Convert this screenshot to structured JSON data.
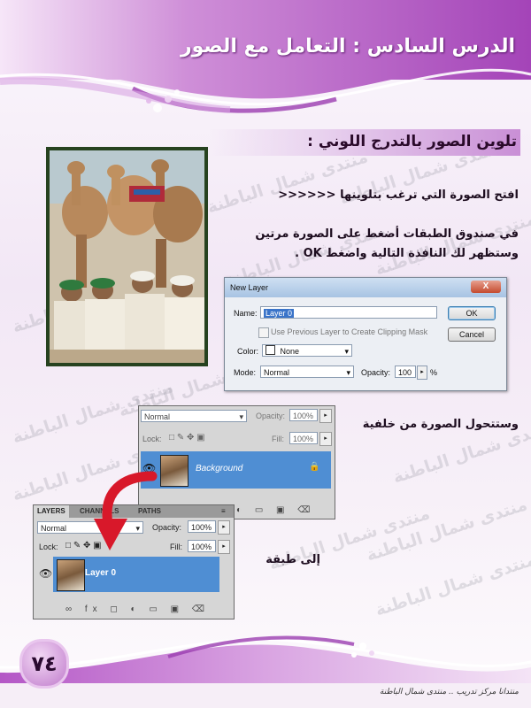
{
  "header": {
    "title": "الدرس السادس : التعامل مع الصور"
  },
  "section": {
    "title": "تلوين الصور بالتدرج اللوني :"
  },
  "watermark": {
    "text": "منتدى شمال الباطنة"
  },
  "instructions": {
    "line1": "افتح الصورة التي ترغب بتلوينها <<<<<<",
    "line2": "في صندوق الطبقات  أضغط على الصورة مرتين",
    "line3": "وستظهر لك النافذة التالية  واضغط OK .",
    "line4": "وستتحول الصورة من خلفية",
    "line5": "إلى طبقة"
  },
  "new_layer_dialog": {
    "title": "New Layer",
    "close_label": "X",
    "name_label": "Name:",
    "name_value": "Layer 0",
    "clipping_label": "Use Previous Layer to Create Clipping Mask",
    "color_label": "Color:",
    "color_value": "None",
    "mode_label": "Mode:",
    "mode_value": "Normal",
    "opacity_label": "Opacity:",
    "opacity_value": "100",
    "opacity_unit": "%",
    "ok_label": "OK",
    "cancel_label": "Cancel"
  },
  "panel_background": {
    "blend_mode": "Normal",
    "opacity_label": "Opacity:",
    "opacity_value": "100%",
    "lock_label": "Lock:",
    "fill_label": "Fill:",
    "fill_value": "100%",
    "layer_name": "Background"
  },
  "panel_layer0": {
    "tabs": [
      "LAYERS",
      "CHANNELS",
      "PATHS"
    ],
    "blend_mode": "Normal",
    "opacity_label": "Opacity:",
    "opacity_value": "100%",
    "lock_label": "Lock:",
    "fill_label": "Fill:",
    "fill_value": "100%",
    "layer_name": "Layer 0"
  },
  "footer": {
    "page_number": "٧٤",
    "credit": "منتدانا مركز تدريب .. منتدى شمال الباطنة"
  },
  "colors": {
    "accent": "#b45fc4",
    "dark_accent": "#7a2a8a",
    "layer_selected": "#4f8ed3"
  }
}
